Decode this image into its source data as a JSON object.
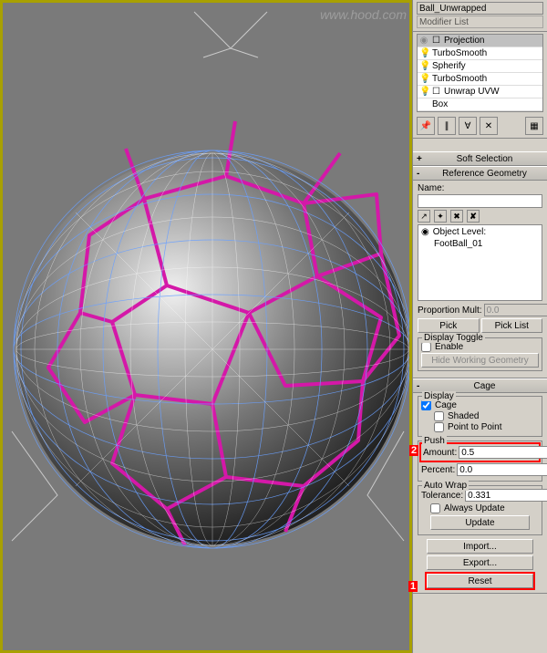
{
  "watermark": "www.hood.com",
  "object_name": "Ball_Unwrapped",
  "mod_list_label": "Modifier List",
  "mod_stack": [
    {
      "name": "Projection",
      "bulb": "◉",
      "selected": true,
      "toggle": "☐"
    },
    {
      "name": "TurboSmooth",
      "bulb": "💡"
    },
    {
      "name": "Spherify",
      "bulb": "💡"
    },
    {
      "name": "TurboSmooth",
      "bulb": "💡"
    },
    {
      "name": "Unwrap UVW",
      "bulb": "💡",
      "toggle": "☐"
    },
    {
      "name": "Box",
      "bulb": ""
    }
  ],
  "mini_toolbar": {
    "pin_icon": "📌",
    "stack1_icon": "∥",
    "stack2_icon": "∀",
    "delete_icon": "✕",
    "config_icon": "▦"
  },
  "rollouts": {
    "soft_selection": {
      "sign": "+",
      "title": "Soft Selection"
    },
    "reference_geometry": {
      "sign": "-",
      "title": "Reference Geometry",
      "name_label": "Name:",
      "name_value": "",
      "mini_icons": {
        "a": "↗",
        "b": "✦",
        "c": "✖",
        "d": "✘"
      },
      "object_level_label": "Object Level:",
      "list_items": [
        "FootBall_01"
      ],
      "proportion_label": "Proportion Mult:",
      "proportion_value": "0.0",
      "pick_label": "Pick",
      "picklist_label": "Pick List",
      "display_toggle_group": "Display Toggle",
      "enable_label": "Enable",
      "hide_btn": "Hide Working Geometry"
    },
    "cage": {
      "sign": "-",
      "title": "Cage",
      "display_group": "Display",
      "cage_label": "Cage",
      "shaded_label": "Shaded",
      "p2p_label": "Point to Point",
      "push_group": "Push",
      "amount_label": "Amount:",
      "amount_value": "0.5",
      "percent_label": "Percent:",
      "percent_value": "0.0",
      "autowrap_group": "Auto Wrap",
      "tolerance_label": "Tolerance:",
      "tolerance_value": "0.331",
      "always_update_label": "Always Update",
      "update_btn": "Update",
      "import_btn": "Import...",
      "export_btn": "Export...",
      "reset_btn": "Reset"
    }
  },
  "callouts": {
    "amount": "2",
    "reset": "1"
  }
}
